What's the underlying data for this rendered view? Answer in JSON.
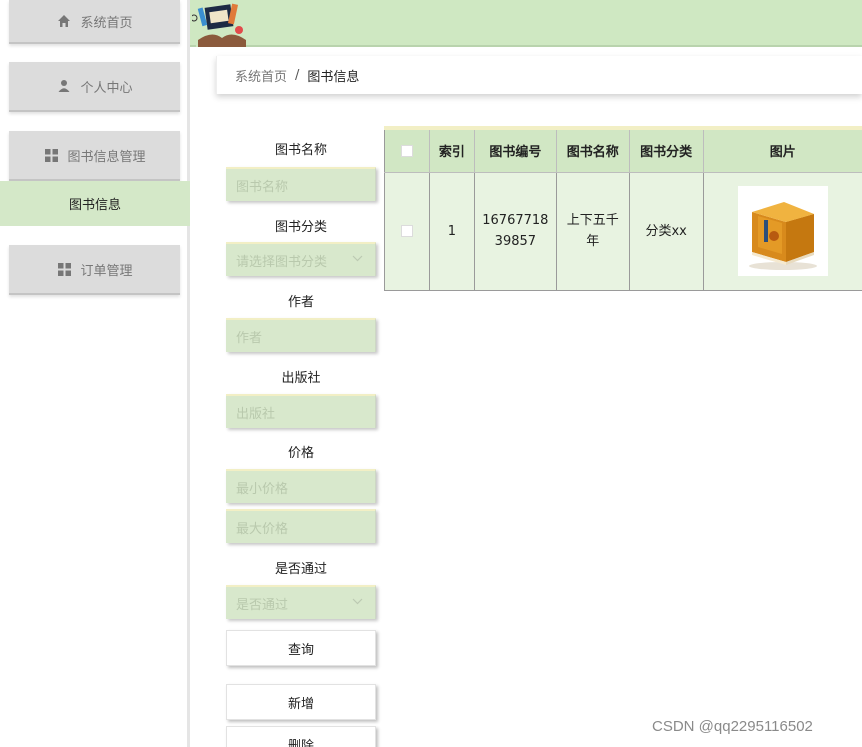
{
  "sidebar": {
    "items": [
      {
        "label": "系统首页",
        "icon": "home-icon"
      },
      {
        "label": "个人中心",
        "icon": "user-icon"
      },
      {
        "label": "图书信息管理",
        "icon": "grid-icon"
      },
      {
        "label": "订单管理",
        "icon": "grid-icon"
      }
    ],
    "sub_item": "图书信息"
  },
  "breadcrumb": {
    "home": "系统首页",
    "separator": "/",
    "current": "图书信息"
  },
  "filters": {
    "book_name_label": "图书名称",
    "book_name_placeholder": "图书名称",
    "category_label": "图书分类",
    "category_placeholder": "请选择图书分类",
    "author_label": "作者",
    "author_placeholder": "作者",
    "publisher_label": "出版社",
    "publisher_placeholder": "出版社",
    "price_label": "价格",
    "min_price_placeholder": "最小价格",
    "max_price_placeholder": "最大价格",
    "approved_label": "是否通过",
    "approved_placeholder": "是否通过",
    "query_button": "查询",
    "add_button": "新增",
    "delete_button": "删除"
  },
  "table": {
    "headers": [
      "索引",
      "图书编号",
      "图书名称",
      "图书分类",
      "图片"
    ],
    "rows": [
      {
        "index": "1",
        "book_no": "1676771839857",
        "book_no_line1": "16767718",
        "book_no_line2": "39857",
        "name_line1": "上下五千",
        "name_line2": "年",
        "category": "分类xx"
      }
    ]
  },
  "watermark": "CSDN @qq2295116502",
  "colors": {
    "accent_green": "#cfe8c2",
    "row_green": "#e8f3e1",
    "input_green": "#d8e8cc",
    "sidebar_gray": "#dcdcdc"
  }
}
